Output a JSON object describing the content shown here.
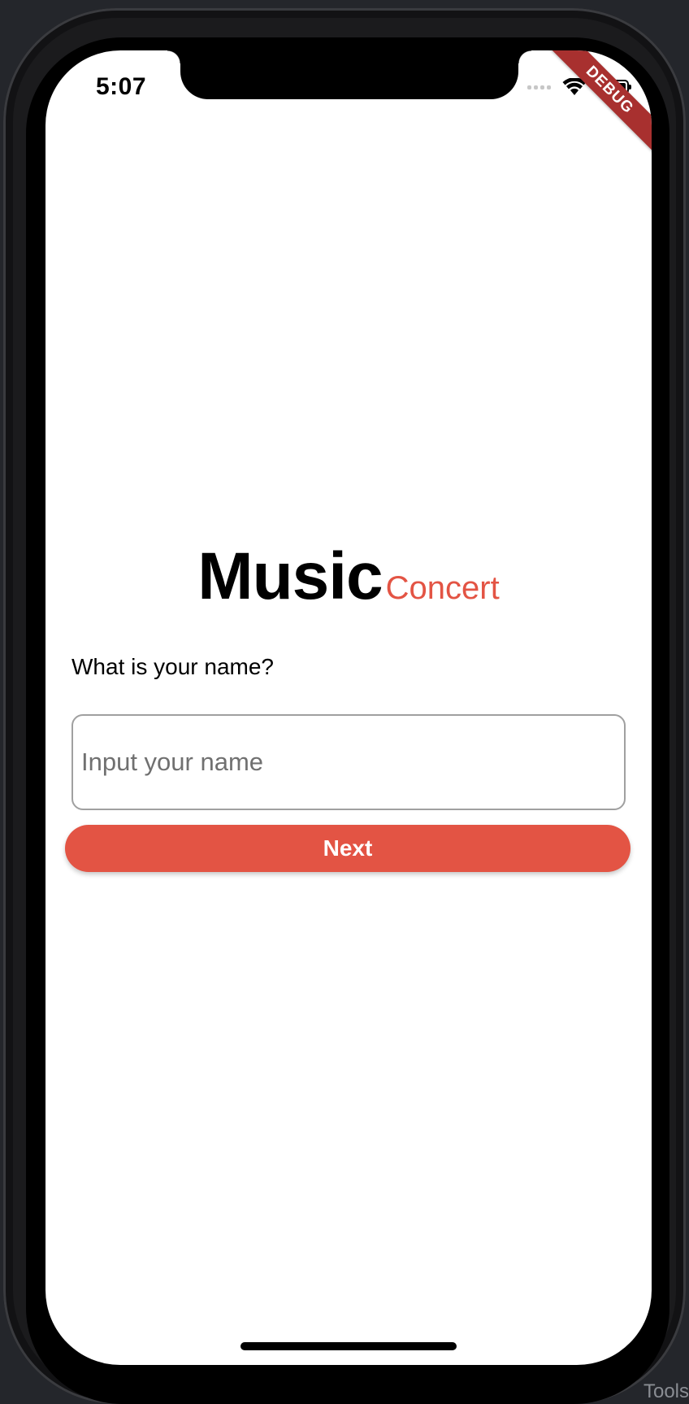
{
  "status_bar": {
    "time": "5:07",
    "icons": [
      "signal-icon",
      "wifi-icon",
      "battery-icon"
    ]
  },
  "debug_banner": "DEBUG",
  "logo": {
    "primary": "Music",
    "secondary": "Concert"
  },
  "form": {
    "question": "What is your name?",
    "name_input": {
      "value": "",
      "placeholder": "Input your name"
    },
    "next_label": "Next"
  },
  "toolbar_tail": "Tools",
  "colors": {
    "accent": "#e35444",
    "debug_banner": "#a8302f",
    "input_border": "#a0a0a0",
    "background": "#ffffff"
  }
}
